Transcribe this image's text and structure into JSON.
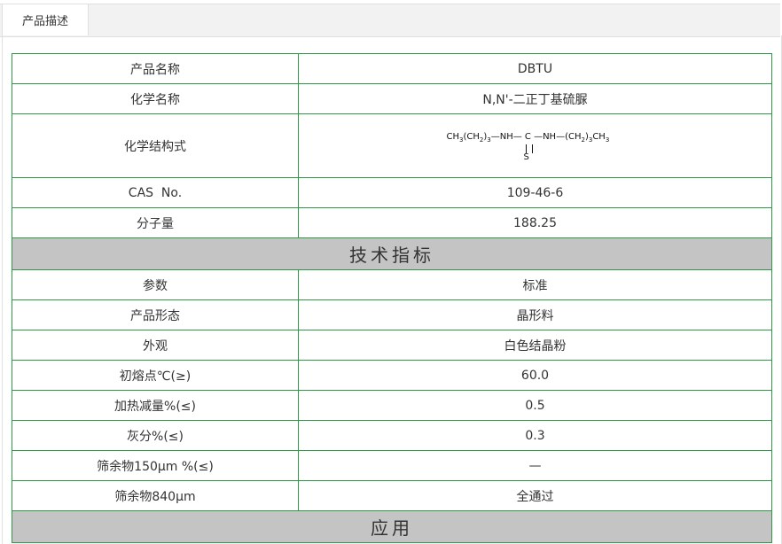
{
  "tab": {
    "label": "产品描述"
  },
  "rows": [
    {
      "label": "产品名称",
      "value": "DBTU"
    },
    {
      "label": "化学名称",
      "value": "N,N'-二正丁基硫脲"
    },
    {
      "label": "化学结构式",
      "formula": {
        "left": "CH",
        "mid": "—NH— C —NH—",
        "right": "(CH",
        "s": "S"
      }
    },
    {
      "label": "CAS  No.",
      "value": "109-46-6"
    },
    {
      "label": "分子量",
      "value": "188.25"
    }
  ],
  "section1": "技术指标",
  "spec_rows": [
    {
      "label": "参数",
      "value": "标准"
    },
    {
      "label": "产品形态",
      "value": "晶形料"
    },
    {
      "label": "外观",
      "value": "白色结晶粉"
    },
    {
      "label": "初熔点℃(≥)",
      "value": "60.0"
    },
    {
      "label": "加热减量%(≤)",
      "value": "0.5"
    },
    {
      "label": "灰分%(≤)",
      "value": "0.3"
    },
    {
      "label": "筛余物150μm %(≤)",
      "value": "—"
    },
    {
      "label": "筛余物840μm",
      "value": "全通过"
    }
  ],
  "section2": "应用"
}
